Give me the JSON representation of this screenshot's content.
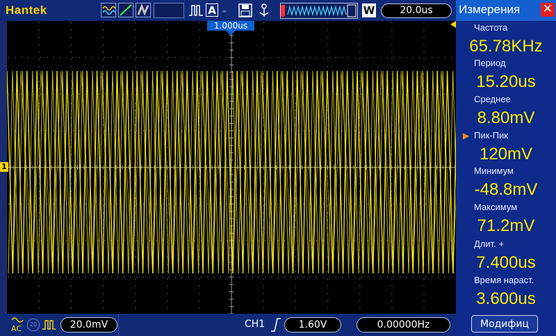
{
  "brand": "Hantek",
  "toolbar": {
    "auto_label": "A",
    "wave_label": "W",
    "timebase": "20.0us",
    "trigger_pos_marker": "1.000us"
  },
  "channel": {
    "marker": "1",
    "vdiv": "20.0mV",
    "trigger_source": "CH1",
    "trigger_level": "1.60V",
    "trigger_freq": "0.00000Hz"
  },
  "panel": {
    "title": "Измерения",
    "close": "✕",
    "measurements": [
      {
        "label": "Частота",
        "value": "65.78KHz"
      },
      {
        "label": "Период",
        "value": "15.20us"
      },
      {
        "label": "Среднее",
        "value": "8.80mV"
      },
      {
        "label": "Пик-Пик",
        "value": "120mV",
        "selected": true
      },
      {
        "label": "Минимум",
        "value": "-48.8mV"
      },
      {
        "label": "Максимум",
        "value": "71.2mV"
      },
      {
        "label": "Длит.  +",
        "value": "7.400us"
      },
      {
        "label": "Время  нараст.",
        "value": "3.600us"
      }
    ],
    "modify_label": "Модифиц"
  },
  "colors": {
    "trace": "#f0e020",
    "accent": "#ffd400",
    "panel": "#0e2a8a"
  }
}
